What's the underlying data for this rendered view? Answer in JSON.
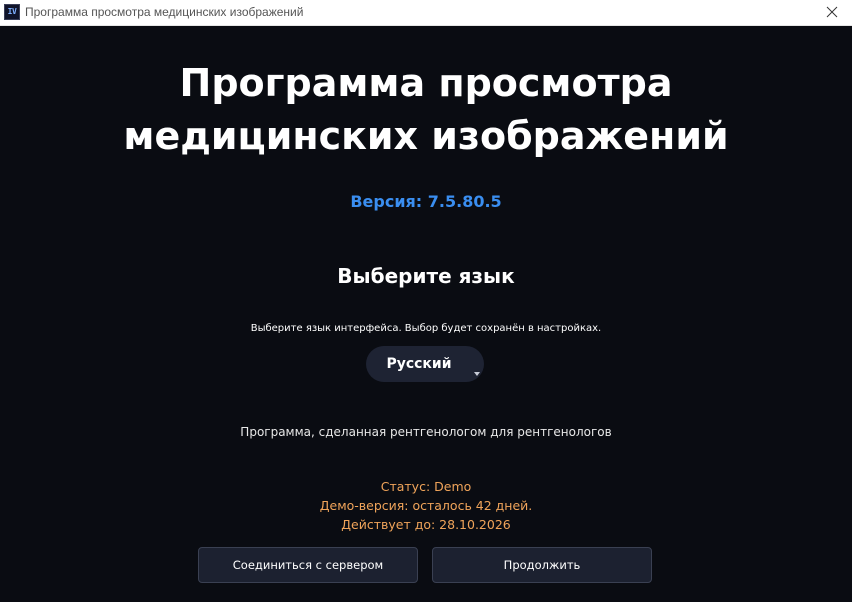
{
  "window": {
    "title": "Программа просмотра медицинских изображений",
    "app_icon_text": "IV"
  },
  "main": {
    "title_line1": "Программа просмотра",
    "title_line2": "медицинских изображений",
    "version": "Версия: 7.5.80.5",
    "language_heading": "Выберите язык",
    "language_hint": "Выберите язык интерфейса. Выбор будет сохранён в настройках.",
    "language_selected": "Русский",
    "tagline": "Программа, сделанная рентгенологом для рентгенологов",
    "status": {
      "status_line": "Статус: Demo",
      "demo_line": "Демо-версия: осталось 42 дней.",
      "valid_until_line": "Действует до: 28.10.2026"
    },
    "buttons": {
      "connect_label": "Соединиться с сервером",
      "continue_label": "Продолжить"
    }
  },
  "colors": {
    "background": "#0a0c12",
    "version_accent": "#3a8ef0",
    "status_text": "#f0a45a",
    "button_bg": "#1c2130",
    "select_bg": "#1e2333"
  },
  "icons": {
    "app": "app-icon",
    "close": "close-icon",
    "dropdown": "chevron-down-icon"
  }
}
